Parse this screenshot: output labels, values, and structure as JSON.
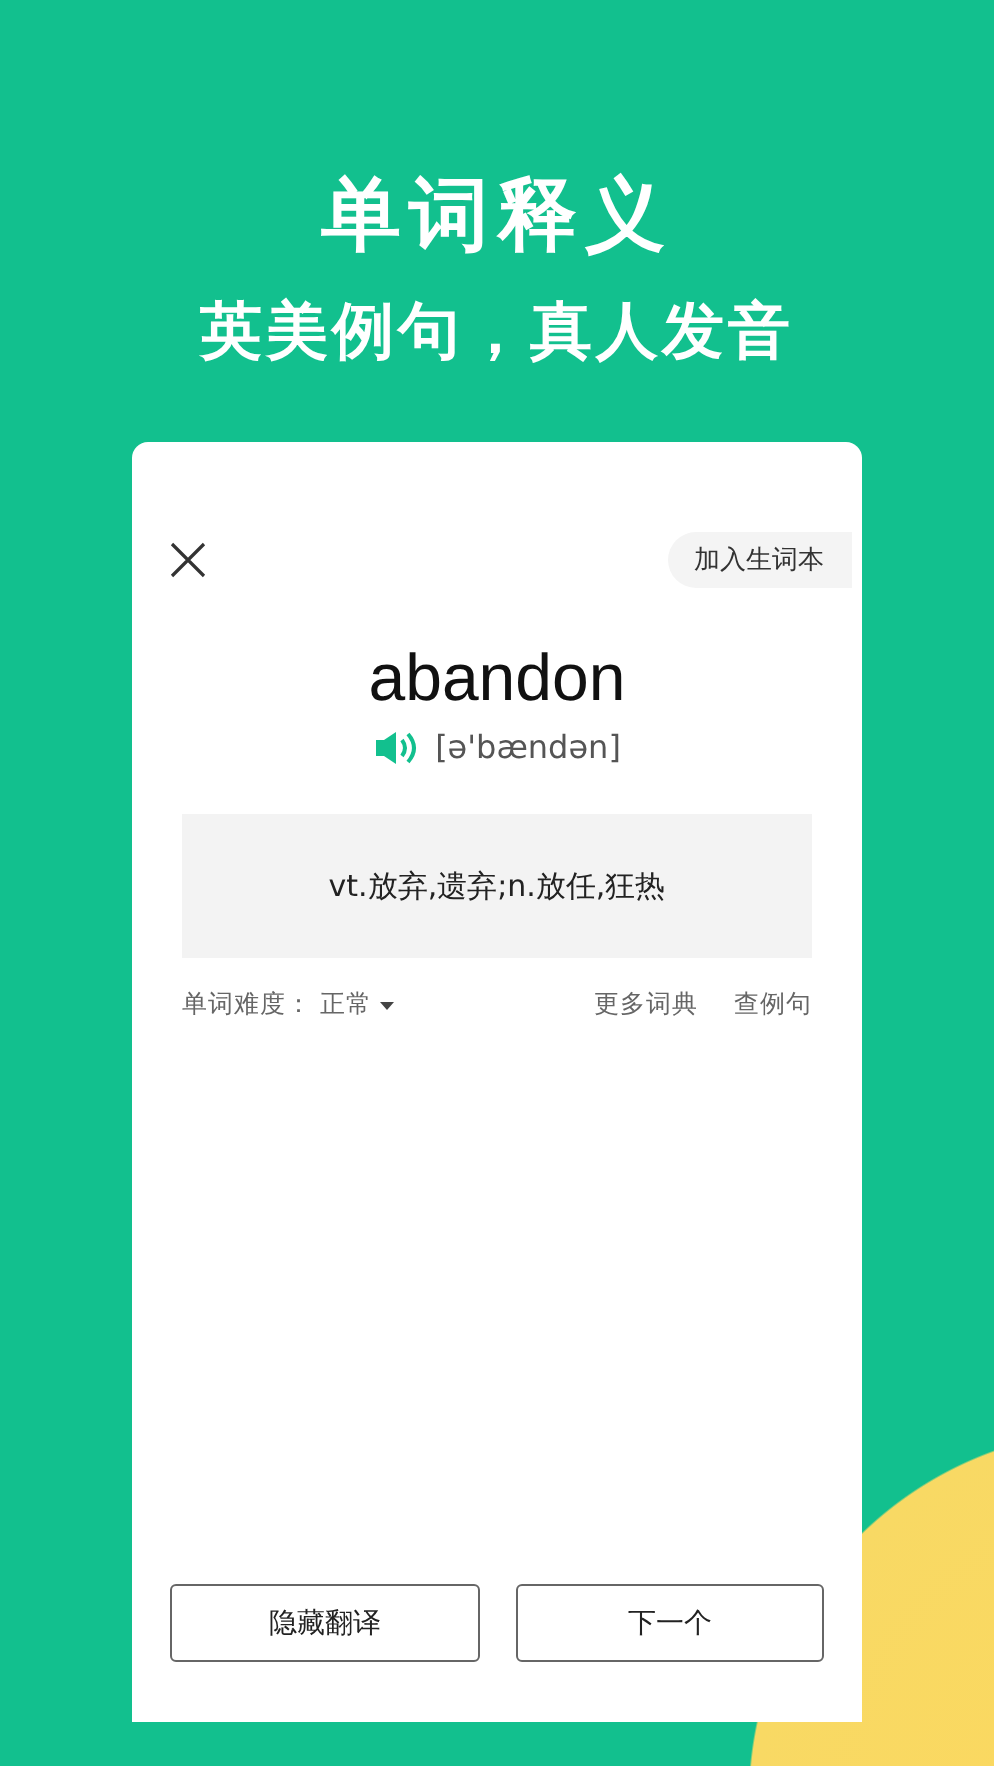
{
  "header": {
    "title": "单词释义",
    "subtitle": "英美例句，真人发音"
  },
  "card": {
    "add_button": "加入生词本",
    "word": "abandon",
    "phonetic": "[ə'bændən]",
    "definition": "vt.放弃,遗弃;n.放任,狂热",
    "difficulty_label": "单词难度：",
    "difficulty_value": "正常",
    "links": [
      "更多词典",
      "查例句"
    ],
    "buttons": [
      "隐藏翻译",
      "下一个"
    ]
  }
}
